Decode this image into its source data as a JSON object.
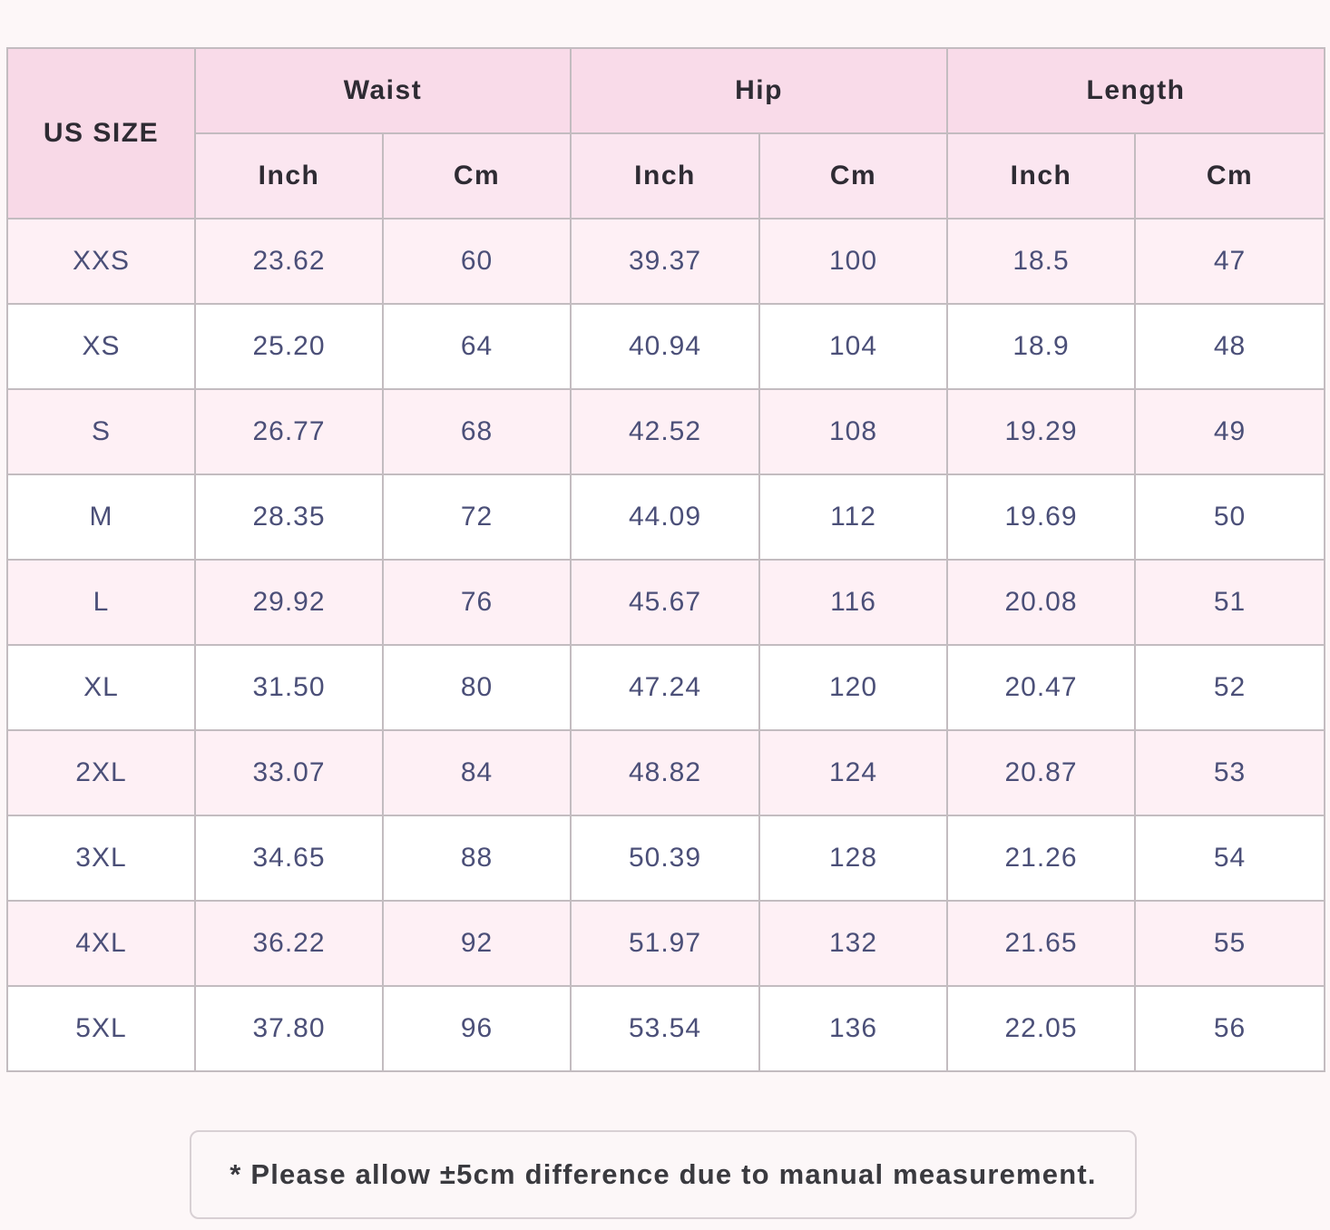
{
  "table": {
    "size_header": "US SIZE",
    "groups": [
      "Waist",
      "Hip",
      "Length"
    ],
    "units": [
      "Inch",
      "Cm",
      "Inch",
      "Cm",
      "Inch",
      "Cm"
    ],
    "rows": [
      [
        "XXS",
        "23.62",
        "60",
        "39.37",
        "100",
        "18.5",
        "47"
      ],
      [
        "XS",
        "25.20",
        "64",
        "40.94",
        "104",
        "18.9",
        "48"
      ],
      [
        "S",
        "26.77",
        "68",
        "42.52",
        "108",
        "19.29",
        "49"
      ],
      [
        "M",
        "28.35",
        "72",
        "44.09",
        "112",
        "19.69",
        "50"
      ],
      [
        "L",
        "29.92",
        "76",
        "45.67",
        "116",
        "20.08",
        "51"
      ],
      [
        "XL",
        "31.50",
        "80",
        "47.24",
        "120",
        "20.47",
        "52"
      ],
      [
        "2XL",
        "33.07",
        "84",
        "48.82",
        "124",
        "20.87",
        "53"
      ],
      [
        "3XL",
        "34.65",
        "88",
        "50.39",
        "128",
        "21.26",
        "54"
      ],
      [
        "4XL",
        "36.22",
        "92",
        "51.97",
        "132",
        "21.65",
        "55"
      ],
      [
        "5XL",
        "37.80",
        "96",
        "53.54",
        "136",
        "22.05",
        "56"
      ]
    ]
  },
  "note": "* Please allow ±5cm difference due to manual measurement.",
  "colors": {
    "header_pink": "#f9dbe9",
    "subheader_pink": "#fbe6f0",
    "row_alt": "#fef0f5",
    "value_text": "#4b4f78",
    "border": "#c3bcc0"
  }
}
